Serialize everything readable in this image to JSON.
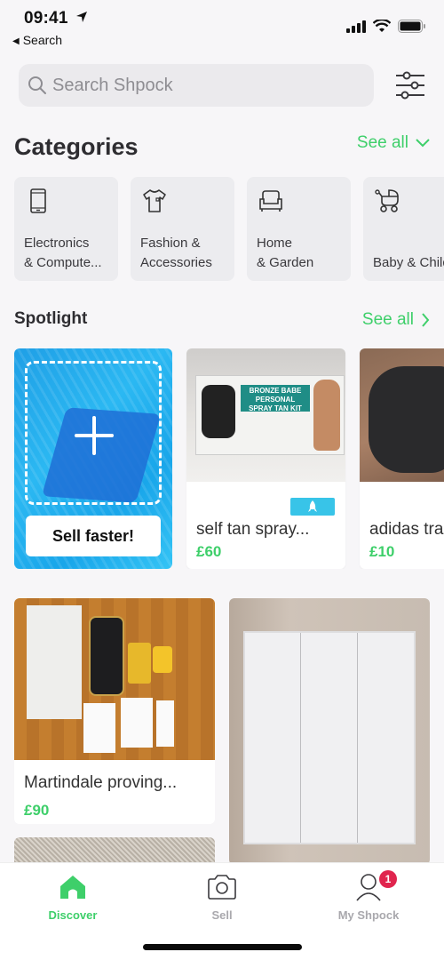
{
  "status_bar": {
    "time": "09:41",
    "back_label": "Search"
  },
  "search": {
    "placeholder": "Search Shpock"
  },
  "categories": {
    "title": "Categories",
    "see_all": "See all",
    "items": [
      {
        "label": "Electronics\n& Compute...",
        "icon": "smartphone-icon"
      },
      {
        "label": "Fashion &\nAccessories",
        "icon": "tshirt-icon"
      },
      {
        "label": "Home\n& Garden",
        "icon": "armchair-icon"
      },
      {
        "label": "\nBaby & Child",
        "icon": "stroller-icon"
      }
    ]
  },
  "spotlight": {
    "title": "Spotlight",
    "see_all": "See all",
    "sell_card": {
      "button_label": "Sell faster!"
    },
    "items": [
      {
        "title": "self tan spray...",
        "price": "£60",
        "boosted": true
      },
      {
        "title": "adidas trainers",
        "price": "£10",
        "boosted": false
      }
    ]
  },
  "grid": {
    "items": [
      {
        "title": "Martindale proving...",
        "price": "£90"
      },
      {
        "title": "",
        "price": ""
      },
      {
        "title": "",
        "price": ""
      }
    ]
  },
  "tab_bar": {
    "tabs": [
      {
        "label": "Discover",
        "active": true
      },
      {
        "label": "Sell",
        "active": false
      },
      {
        "label": "My Shpock",
        "active": false,
        "badge": "1"
      }
    ]
  },
  "colors": {
    "accent": "#3ecf6a",
    "badge": "#e0254e",
    "boost": "#38c4e8"
  }
}
